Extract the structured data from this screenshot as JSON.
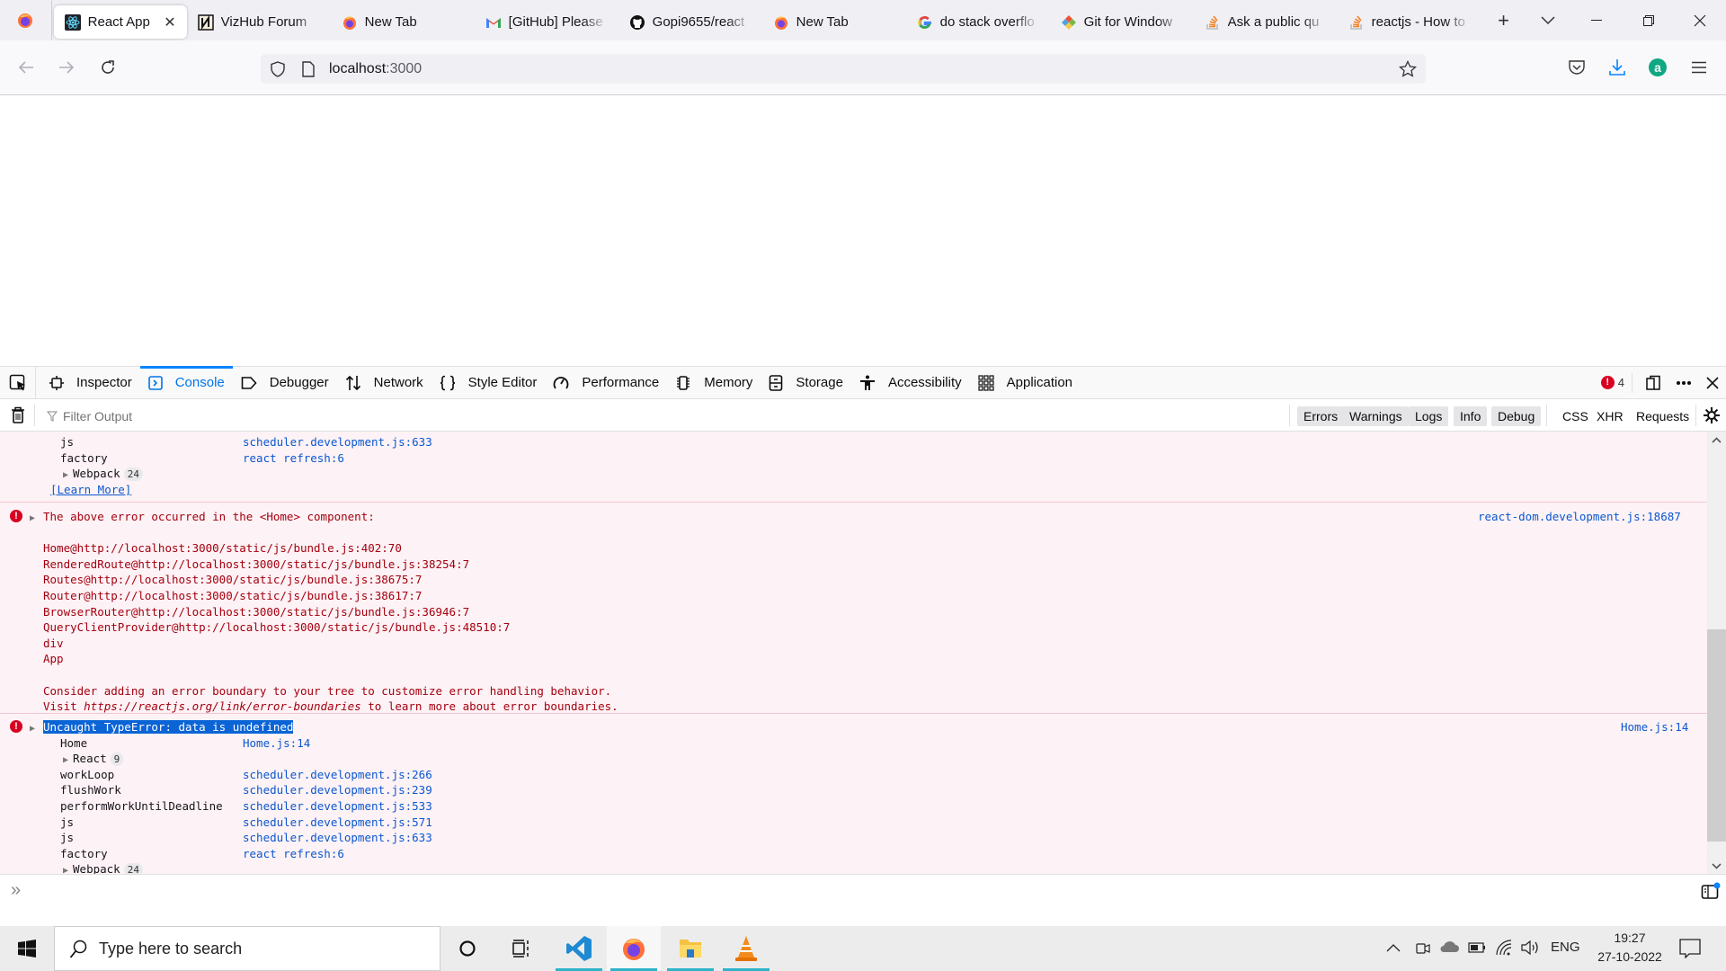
{
  "browser": {
    "tabs": [
      {
        "label": "React App",
        "icon": "react-icon",
        "active": true
      },
      {
        "label": "VizHub Forum",
        "icon": "vizhub-icon"
      },
      {
        "label": "New Tab",
        "icon": "firefox-icon"
      },
      {
        "label": "[GitHub] Please",
        "icon": "gmail-icon"
      },
      {
        "label": "Gopi9655/react",
        "icon": "github-icon"
      },
      {
        "label": "New Tab",
        "icon": "firefox-icon"
      },
      {
        "label": "do stack overflo",
        "icon": "google-icon"
      },
      {
        "label": "Git for Window",
        "icon": "git-icon"
      },
      {
        "label": "Ask a public qu",
        "icon": "stackoverflow-icon"
      },
      {
        "label": "reactjs - How to",
        "icon": "stackoverflow-icon"
      }
    ],
    "close_tab_glyph": "✕",
    "new_tab_glyph": "+",
    "list_tabs_glyph": "⌄",
    "url": {
      "host": "localhost",
      "port": ":3000"
    }
  },
  "devtools": {
    "tabs": [
      {
        "label": "Inspector",
        "icon": "inspector-icon"
      },
      {
        "label": "Console",
        "icon": "console-icon",
        "active": true
      },
      {
        "label": "Debugger",
        "icon": "debugger-icon"
      },
      {
        "label": "Network",
        "icon": "network-icon"
      },
      {
        "label": "Style Editor",
        "icon": "style-editor-icon"
      },
      {
        "label": "Performance",
        "icon": "performance-icon"
      },
      {
        "label": "Memory",
        "icon": "memory-icon"
      },
      {
        "label": "Storage",
        "icon": "storage-icon"
      },
      {
        "label": "Accessibility",
        "icon": "accessibility-icon"
      },
      {
        "label": "Application",
        "icon": "application-icon"
      }
    ],
    "error_count": "4",
    "filter_placeholder": "Filter Output",
    "filter_buttons": [
      "Errors",
      "Warnings",
      "Logs",
      "Info",
      "Debug"
    ],
    "extra_filters": [
      "CSS",
      "XHR",
      "Requests"
    ]
  },
  "console": {
    "prev_stack": [
      {
        "fn": "js",
        "loc": "scheduler.development.js:633"
      },
      {
        "fn": "factory",
        "loc": "react refresh:6"
      }
    ],
    "prev_group": {
      "name": "Webpack",
      "count": "24"
    },
    "learn_more": "[Learn More]",
    "message1": {
      "text": "The above error occurred in the <Home> component:",
      "source": "react-dom.development.js:18687",
      "stack": [
        "Home@http://localhost:3000/static/js/bundle.js:402:70",
        "RenderedRoute@http://localhost:3000/static/js/bundle.js:38254:7",
        "Routes@http://localhost:3000/static/js/bundle.js:38675:7",
        "Router@http://localhost:3000/static/js/bundle.js:38617:7",
        "BrowserRouter@http://localhost:3000/static/js/bundle.js:36946:7",
        "QueryClientProvider@http://localhost:3000/static/js/bundle.js:48510:7",
        "div",
        "App"
      ],
      "advice1": "Consider adding an error boundary to your tree to customize error handling behavior.",
      "advice2_pre": "Visit ",
      "advice2_link": "https://reactjs.org/link/error-boundaries",
      "advice2_post": " to learn more about error boundaries."
    },
    "message2": {
      "text": "Uncaught TypeError: data is undefined",
      "source": "Home.js:14",
      "stack": [
        {
          "fn": "Home",
          "loc": "Home.js:14"
        },
        {
          "group": "React",
          "count": "9"
        },
        {
          "fn": "workLoop",
          "loc": "scheduler.development.js:266"
        },
        {
          "fn": "flushWork",
          "loc": "scheduler.development.js:239"
        },
        {
          "fn": "performWorkUntilDeadline",
          "loc": "scheduler.development.js:533"
        },
        {
          "fn": "js",
          "loc": "scheduler.development.js:571"
        },
        {
          "fn": "js",
          "loc": "scheduler.development.js:633"
        },
        {
          "fn": "factory",
          "loc": "react refresh:6"
        },
        {
          "group": "Webpack",
          "count": "24"
        }
      ]
    },
    "prompt_glyph": "»"
  },
  "taskbar": {
    "search_placeholder": "Type here to search",
    "apps": [
      "cortana",
      "task-view",
      "vscode",
      "firefox",
      "file-explorer",
      "vlc"
    ],
    "language": "ENG",
    "time": "19:27",
    "date": "27-10-2022"
  }
}
